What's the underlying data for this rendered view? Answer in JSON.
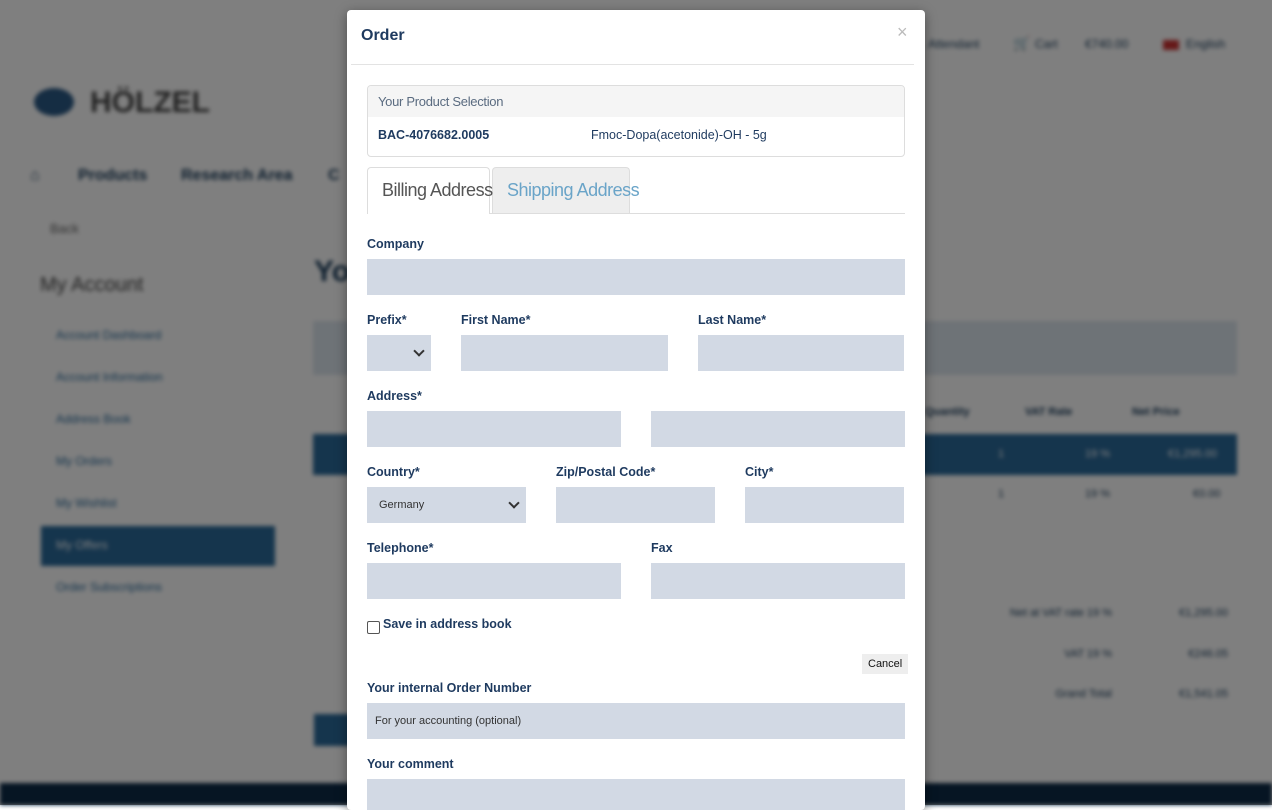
{
  "background": {
    "header": {
      "account_label": "Attendant",
      "cart_label": "Cart",
      "cart_total": "€740.00",
      "language": "English"
    },
    "logo_text": "HÖLZEL",
    "nav": [
      "Products",
      "Research Area",
      "C"
    ],
    "back_label": "Back",
    "sidebar": {
      "title": "My Account",
      "items": [
        {
          "label": "Account Dashboard",
          "active": false
        },
        {
          "label": "Account Information",
          "active": false
        },
        {
          "label": "Address Book",
          "active": false
        },
        {
          "label": "My Orders",
          "active": false
        },
        {
          "label": "My Wishlist",
          "active": false
        },
        {
          "label": "My Offers",
          "active": true
        },
        {
          "label": "Order Subscriptions",
          "active": false
        }
      ]
    },
    "page_title": "Yo",
    "table": {
      "headers": [
        "Quantity",
        "VAT Rate",
        "Net Price"
      ],
      "rows": [
        [
          "1",
          "19 %",
          "€1,295.00"
        ],
        [
          "1",
          "19 %",
          "€0.00"
        ]
      ]
    },
    "totals": [
      {
        "label": "Net at VAT rate 19 %",
        "value": "€1,295.00"
      },
      {
        "label": "VAT 19 %",
        "value": "€246.05"
      },
      {
        "label": "Grand Total",
        "value": "€1,541.05"
      }
    ]
  },
  "modal": {
    "title": "Order",
    "close_icon": "×",
    "product_selection": {
      "heading": "Your Product Selection",
      "sku": "BAC-4076682.0005",
      "name": "Fmoc-Dopa(acetonide)-OH - 5g"
    },
    "tabs": [
      {
        "label": "Billing Address",
        "active": true
      },
      {
        "label": "Shipping Address",
        "active": false
      }
    ],
    "form": {
      "company": "Company",
      "prefix": "Prefix*",
      "first_name": "First Name*",
      "last_name": "Last Name*",
      "address": "Address*",
      "country": "Country*",
      "country_value": "Germany",
      "zip": "Zip/Postal Code*",
      "city": "City*",
      "telephone": "Telephone*",
      "fax": "Fax",
      "save_address": "Save in address book",
      "cancel": "Cancel",
      "order_number": "Your internal Order Number",
      "order_number_placeholder": "For your accounting (optional)",
      "comment": "Your comment"
    }
  },
  "colors": {
    "primary": "#1e3a5f",
    "input_bg": "#d2d9e4",
    "tab_inactive_text": "#6aa4c8"
  }
}
